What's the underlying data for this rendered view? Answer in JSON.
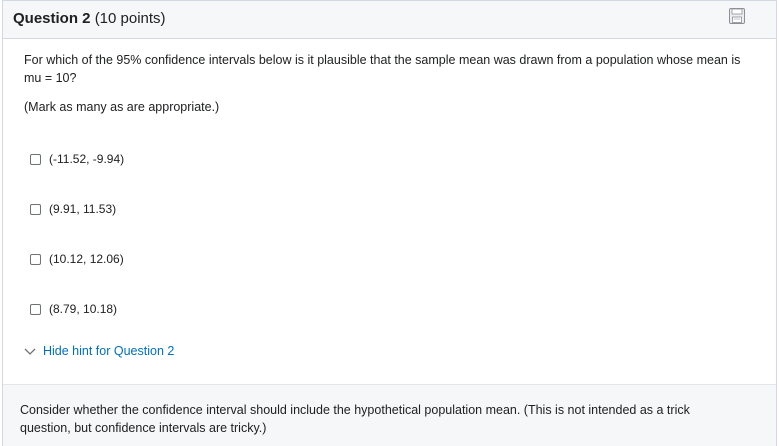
{
  "question": {
    "number_label": "Question 2",
    "points_label": "(10 points)",
    "prompt": "For which of the 95% confidence intervals below is it plausible that the sample mean was drawn from a population whose mean is mu = 10?",
    "instruction": "(Mark as many as are appropriate.)",
    "options": [
      {
        "label": "(-11.52, -9.94)",
        "checked": false
      },
      {
        "label": "(9.91, 11.53)",
        "checked": false
      },
      {
        "label": "(10.12, 12.06)",
        "checked": false
      },
      {
        "label": "(8.79, 10.18)",
        "checked": false
      }
    ],
    "save_icon": "save-icon"
  },
  "hint": {
    "toggle_label": "Hide hint for Question 2",
    "toggle_icon": "chevron-down-icon",
    "text": "Consider whether the confidence interval should include the hypothetical population mean. (This is not intended as a trick question, but confidence intervals are tricky.)"
  },
  "colors": {
    "link": "#006fbf",
    "header_bg": "#f6f7f8",
    "border": "#d3d9e3"
  }
}
